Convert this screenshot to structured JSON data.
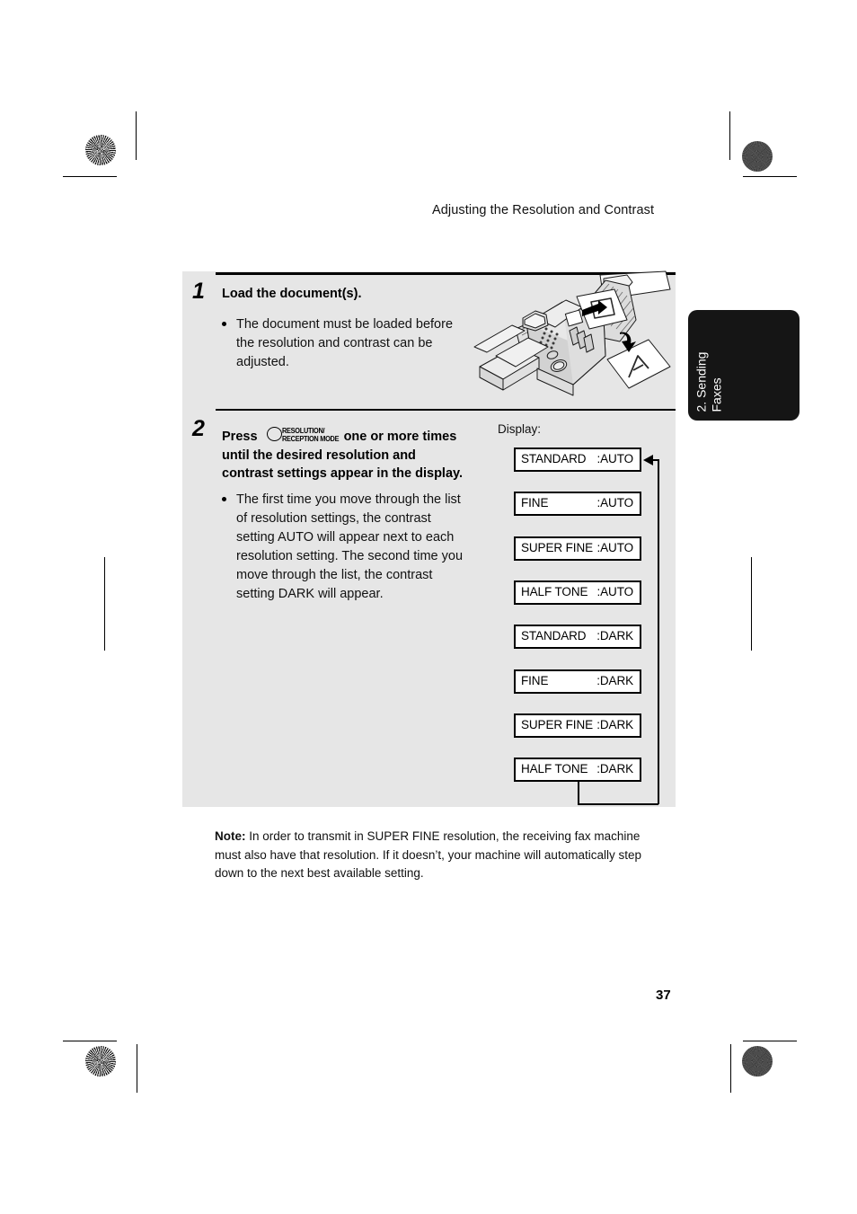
{
  "document": {
    "running_head": "Adjusting the Resolution and Contrast",
    "page_number": "37",
    "chapter_tab": {
      "line1": "2. Sending",
      "line2": "Faxes"
    }
  },
  "steps": [
    {
      "number": "1",
      "title": "Load the document(s).",
      "bullets": [
        "The document must be loaded before the resolution and contrast can be adjusted."
      ]
    },
    {
      "number": "2",
      "press_prefix": "Press",
      "key": {
        "line1": "RESOLUTION/",
        "line2": "RECEPTION MODE",
        "icon": "oval-button-icon"
      },
      "press_suffix": "one or more times",
      "title_rest": "until the desired resolution and\ncontrast settings appear in the display.",
      "bullets": [
        "The first time you move through the list of resolution settings, the contrast setting AUTO will appear next to each resolution setting. The second time you move through the list, the contrast setting DARK will appear."
      ]
    }
  ],
  "flow": {
    "label": "Display:",
    "boxes": [
      {
        "mode": "STANDARD",
        "contrast": ":AUTO"
      },
      {
        "mode": "FINE",
        "contrast": ":AUTO"
      },
      {
        "mode": "SUPER FINE",
        "contrast": ":AUTO"
      },
      {
        "mode": "HALF TONE",
        "contrast": ":AUTO"
      },
      {
        "mode": "STANDARD",
        "contrast": ":DARK"
      },
      {
        "mode": "FINE",
        "contrast": ":DARK"
      },
      {
        "mode": "SUPER FINE",
        "contrast": ":DARK"
      },
      {
        "mode": "HALF TONE",
        "contrast": ":DARK"
      }
    ]
  },
  "note": {
    "label": "Note:",
    "text": " In order to transmit in SUPER FINE resolution, the receiving fax machine must also have that resolution. If it doesn’t, your machine will automatically step down to the next best available setting."
  },
  "colors": {
    "panel_background": "#e6e6e6",
    "tab_background": "#151515",
    "page_background": "#ffffff",
    "ink": "#000000"
  }
}
